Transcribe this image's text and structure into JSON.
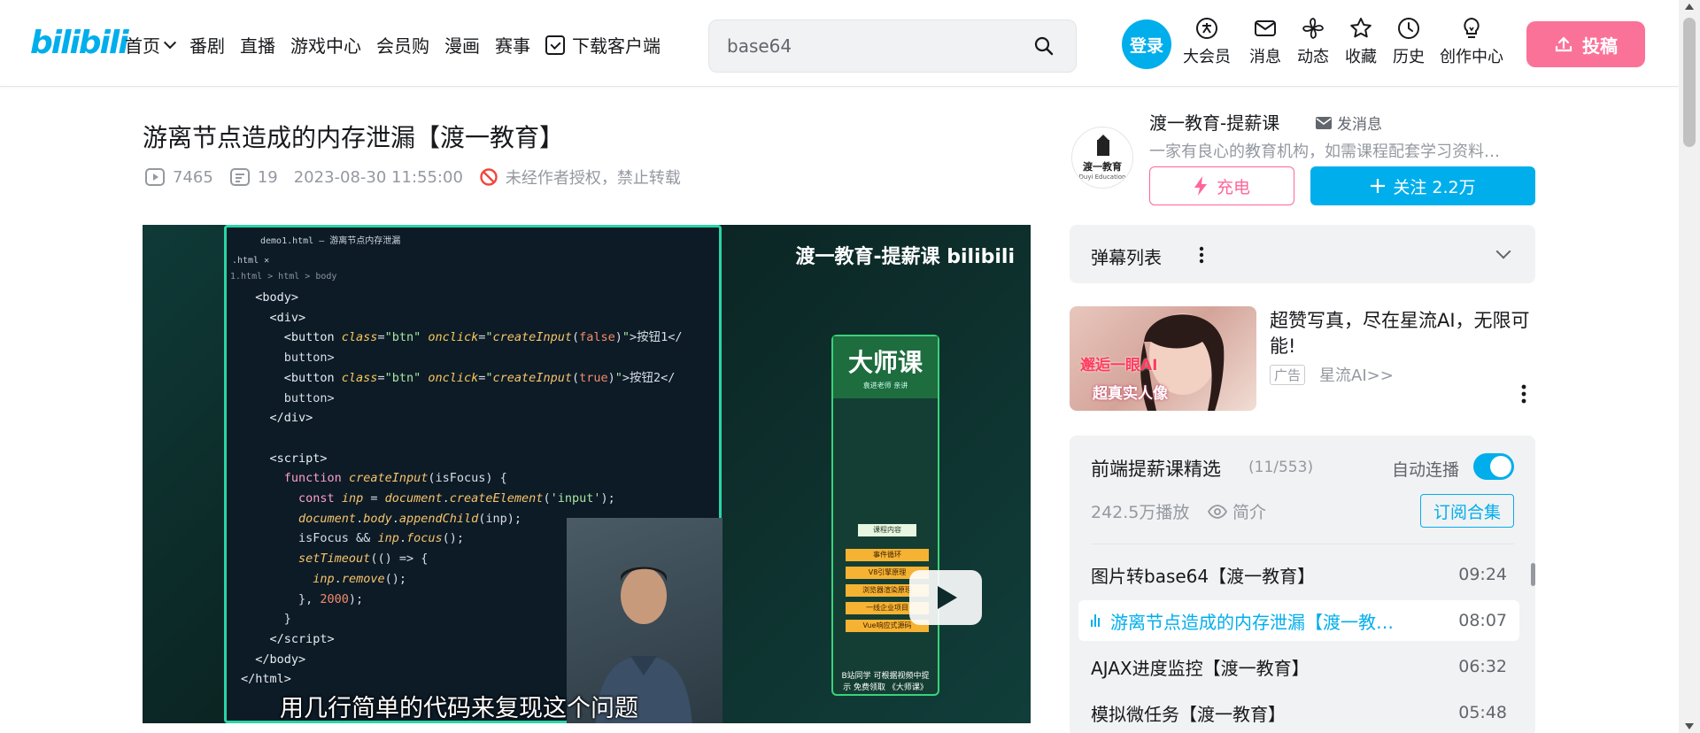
{
  "header": {
    "logo": "bilibili",
    "nav": [
      {
        "label": "首页"
      },
      {
        "label": "番剧"
      },
      {
        "label": "直播"
      },
      {
        "label": "游戏中心"
      },
      {
        "label": "会员购"
      },
      {
        "label": "漫画"
      },
      {
        "label": "赛事"
      },
      {
        "label": "下载客户端"
      }
    ],
    "search_value": "base64",
    "login": "登录",
    "icons": [
      {
        "label": "大会员",
        "icon": "vip-icon"
      },
      {
        "label": "消息",
        "icon": "mail-icon"
      },
      {
        "label": "动态",
        "icon": "pinwheel-icon"
      },
      {
        "label": "收藏",
        "icon": "star-icon"
      },
      {
        "label": "历史",
        "icon": "clock-icon"
      },
      {
        "label": "创作中心",
        "icon": "bulb-icon"
      }
    ],
    "upload": "投稿"
  },
  "video": {
    "title": "游离节点造成的内存泄漏【渡一教育】",
    "views": "7465",
    "danmaku_count": "19",
    "date": "2023-08-30 11:55:00",
    "copyright": "未经作者授权，禁止转载",
    "player": {
      "window_title": "demo1.html — 游离节点内存泄漏",
      "tab": ".html",
      "breadcrumb": "1.html > html > body",
      "brand": "渡一教育-提薪课 bilibili",
      "subtitle": "用几行简单的代码来复现这个问题",
      "card_title": "大师课",
      "card_sub": "袁进老师 亲讲",
      "card_header": "课程内容",
      "card_items": [
        "事件循环",
        "V8引擎原理",
        "浏览器渲染原理",
        "一线企业项目",
        "Vue响应式源码"
      ],
      "card_bottom": "B站同学 可根据视频中提示 免费领取 《大师课》"
    }
  },
  "uploader": {
    "avatar_text": "渡一教育",
    "avatar_sub": "Duyi Education",
    "name": "渡一教育-提薪课",
    "message": "发消息",
    "desc": "一家有良心的教育机构，如需课程配套学习资料…",
    "charge": "充电",
    "follow": "关注 2.2万"
  },
  "danmaku": {
    "label": "弹幕列表"
  },
  "ad": {
    "image_text1": "邂逅一眼AI",
    "image_text2": "超真实人像",
    "title": "超赞写真，尽在星流AI，无限可能!",
    "tag": "广告",
    "source": "星流AI>>"
  },
  "playlist": {
    "title": "前端提薪课精选",
    "count": "(11/553)",
    "autoplay": "自动连播",
    "autoplay_on": true,
    "plays": "242.5万播放",
    "intro": "简介",
    "subscribe": "订阅合集",
    "items": [
      {
        "name": "图片转base64【渡一教育】",
        "duration": "09:24"
      },
      {
        "name": "游离节点造成的内存泄漏【渡一教…",
        "duration": "08:07",
        "active": true
      },
      {
        "name": "AJAX进度监控【渡一教育】",
        "duration": "06:32"
      },
      {
        "name": "模拟微任务【渡一教育】",
        "duration": "05:48"
      }
    ]
  },
  "colors": {
    "brand_blue": "#00aeec",
    "brand_pink": "#fb7299",
    "text_secondary": "#9499a0"
  }
}
